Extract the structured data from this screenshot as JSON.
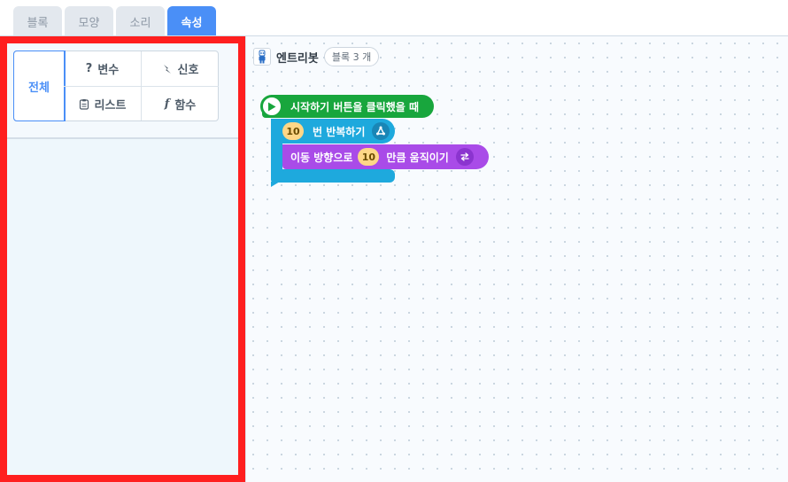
{
  "tabs": [
    {
      "label": "블록",
      "active": false
    },
    {
      "label": "모양",
      "active": false
    },
    {
      "label": "소리",
      "active": false
    },
    {
      "label": "속성",
      "active": true
    }
  ],
  "categories": {
    "all": "전체",
    "variable": "변수",
    "signal": "신호",
    "list": "리스트",
    "function": "함수"
  },
  "object": {
    "name": "엔트리봇",
    "block_count": "블록 3 개",
    "icon": "entrybot-icon"
  },
  "blocks": {
    "start": "시작하기 버튼을 클릭했을 때",
    "repeat": {
      "count": "10",
      "label": "번 반복하기"
    },
    "move": {
      "label1": "이동 방향으로",
      "value": "10",
      "label2": "만큼 움직이기"
    }
  },
  "colors": {
    "accent": "#4a8ff7",
    "highlight_border": "#ff1f1f",
    "start_block": "#18a63d",
    "flow_block": "#1ea9dd",
    "move_block": "#a94be8",
    "number_input": "#ffd787"
  }
}
